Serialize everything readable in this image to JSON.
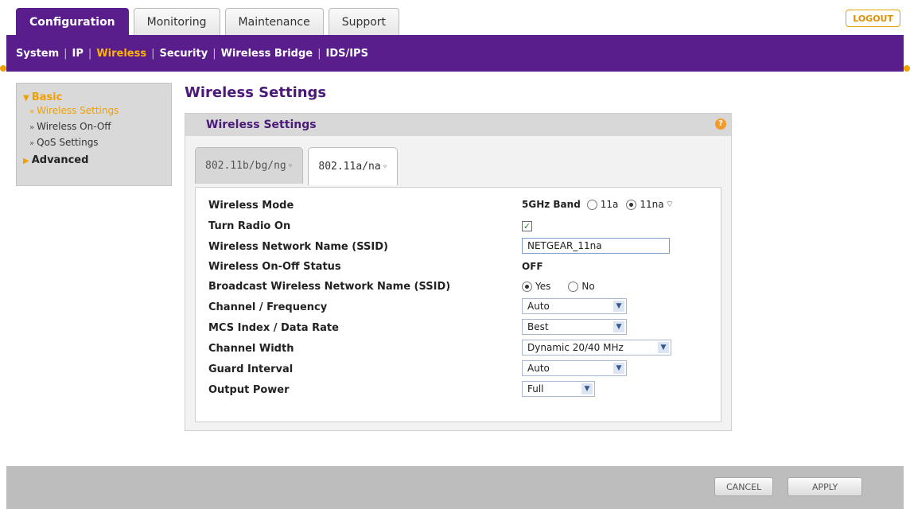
{
  "top_tabs": [
    "Configuration",
    "Monitoring",
    "Maintenance",
    "Support"
  ],
  "logout_label": "LOGOUT",
  "sub_nav": [
    "System",
    "IP",
    "Wireless",
    "Security",
    "Wireless Bridge",
    "IDS/IPS"
  ],
  "left_menu": {
    "basic_label": "Basic",
    "items": [
      "Wireless Settings",
      "Wireless On-Off",
      "QoS Settings"
    ],
    "advanced_label": "Advanced"
  },
  "page_title": "Wireless Settings",
  "panel_title": "Wireless Settings",
  "band_tabs": [
    "802.11b/bg/ng",
    "802.11a/na"
  ],
  "form": {
    "wireless_mode_label": "Wireless Mode",
    "band_label": "5GHz Band",
    "mode_11a": "11a",
    "mode_11na": "11na",
    "radio_on_label": "Turn Radio On",
    "ssid_label": "Wireless Network Name (SSID)",
    "ssid_value": "NETGEAR_11na",
    "onoff_status_label": "Wireless On-Off Status",
    "onoff_status_value": "OFF",
    "broadcast_label": "Broadcast Wireless Network Name (SSID)",
    "yes_label": "Yes",
    "no_label": "No",
    "channel_label": "Channel / Frequency",
    "channel_value": "Auto",
    "mcs_label": "MCS Index / Data Rate",
    "mcs_value": "Best",
    "width_label": "Channel Width",
    "width_value": "Dynamic 20/40 MHz",
    "guard_label": "Guard Interval",
    "guard_value": "Auto",
    "power_label": "Output Power",
    "power_value": "Full"
  },
  "buttons": {
    "cancel": "CANCEL",
    "apply": "APPLY"
  }
}
